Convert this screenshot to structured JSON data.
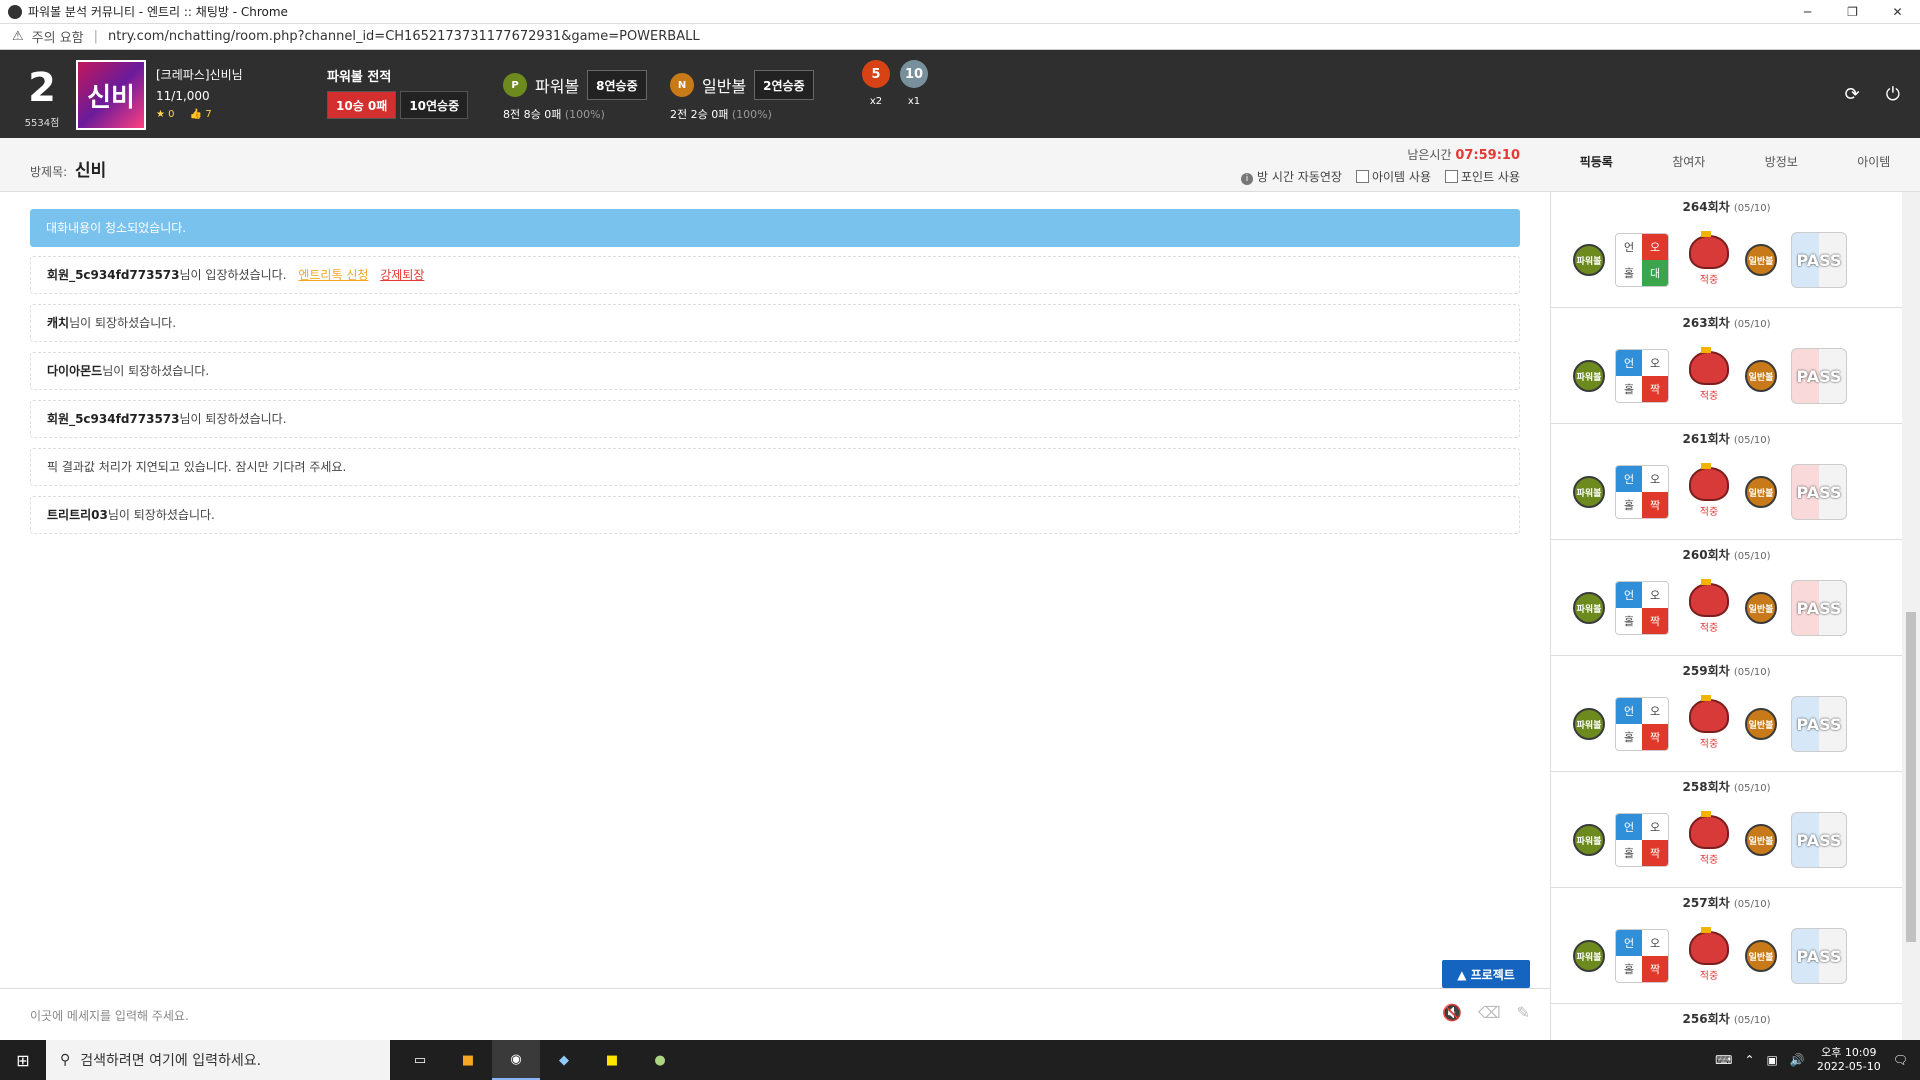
{
  "window": {
    "title": "파워볼 분석 커뮤니티 - 엔트리 :: 채팅방 - Chrome",
    "minimize": "─",
    "restore": "❐",
    "close": "✕"
  },
  "address": {
    "warning_icon": "⚠",
    "warning_text": "주의 요함",
    "url": "ntry.com/nchatting/room.php?channel_id=CH1652173731177672931&game=POWERBALL"
  },
  "header": {
    "level": "2",
    "points": "5534점",
    "avatar_text": "신비",
    "username": "[크레파스]신비님",
    "exp": "11/1,000",
    "stars": "★ 0",
    "likes": "👍 7",
    "record_label": "파워볼 전적",
    "record_wins": "10승 0패",
    "record_streak": "10연승중",
    "powerball": {
      "icon": "P",
      "label": "파워볼",
      "streak": "8연승중",
      "summary": "8전 8승 0패",
      "pct": "(100%)"
    },
    "normalball": {
      "icon": "N",
      "label": "일반볼",
      "streak": "2연승중",
      "summary": "2전 2승 0패",
      "pct": "(100%)"
    },
    "medals": [
      {
        "value": "5",
        "mult": "x2",
        "color": "#d84315"
      },
      {
        "value": "10",
        "mult": "x1",
        "color": "#78909c"
      }
    ],
    "refresh_icon": "⟳",
    "power_icon": "⏻"
  },
  "room": {
    "label": "방제목:",
    "name": "신비",
    "remain_label": "남은시간",
    "remain_time": "07:59:10",
    "auto_extend": "방 시간 자동연장",
    "use_item": "아이템 사용",
    "use_point": "포인트 사용"
  },
  "side_tabs": [
    "픽등록",
    "참여자",
    "방정보",
    "아이템"
  ],
  "chat": {
    "notice": "대화내용이 청소되었습니다.",
    "messages": [
      {
        "user": "회원_5c934fd773573",
        "text": "님이 입장하셨습니다.",
        "link1": "엔트리톡 신청",
        "link2": "강제퇴장"
      },
      {
        "user": "캐치",
        "text": "님이 퇴장하셨습니다."
      },
      {
        "user": "다이아몬드",
        "text": "님이 퇴장하셨습니다."
      },
      {
        "user": "회원_5c934fd773573",
        "text": "님이 퇴장하셨습니다."
      },
      {
        "user": "",
        "text": "픽 결과값 처리가 지연되고 있습니다. 잠시만 기다려 주세요."
      },
      {
        "user": "트리트리03",
        "text": "님이 퇴장하셨습니다."
      }
    ],
    "project_button": "▲ 프로젝트",
    "input_placeholder": "이곳에 메세지를 입력해 주세요."
  },
  "rounds": [
    {
      "round": "264회차",
      "date": "(05/10)",
      "pass_color": "blue"
    },
    {
      "round": "263회차",
      "date": "(05/10)",
      "pass_color": "red"
    },
    {
      "round": "261회차",
      "date": "(05/10)",
      "pass_color": "red"
    },
    {
      "round": "260회차",
      "date": "(05/10)",
      "pass_color": "red"
    },
    {
      "round": "259회차",
      "date": "(05/10)",
      "pass_color": "blue"
    },
    {
      "round": "258회차",
      "date": "(05/10)",
      "pass_color": "blue"
    },
    {
      "round": "257회차",
      "date": "(05/10)",
      "pass_color": "blue"
    },
    {
      "round": "256회차",
      "date": "(05/10)",
      "pass_color": "blue"
    }
  ],
  "round_labels": {
    "power_ball": "파워볼",
    "normal_ball": "일반볼",
    "cell_tl": "언",
    "cell_tr": "오",
    "cell_bl": "홀",
    "cell_br": "짝",
    "cell_mid": "대",
    "hit": "적중",
    "pass": "PASS"
  },
  "taskbar": {
    "start_icon": "⊞",
    "search_icon": "⚲",
    "search_placeholder": "검색하려면 여기에 입력하세요.",
    "time": "오후 10:09",
    "date": "2022-05-10"
  }
}
